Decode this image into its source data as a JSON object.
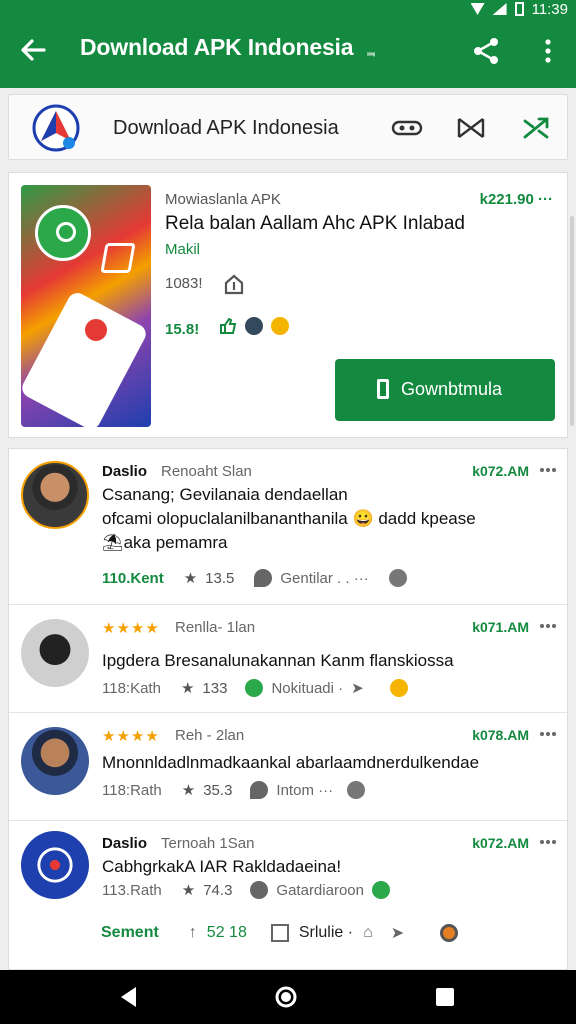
{
  "status_bar": {
    "time": "11:39"
  },
  "app_bar": {
    "title": "Download APK Indonesia",
    "title_suffix": "ᆿ"
  },
  "header": {
    "title": "Download APK Indonesia"
  },
  "app": {
    "subtitle": "Mowiaslanla APK",
    "price": "k221.90",
    "name": "Rela balan Aallam Ahc APK Inlabad",
    "vendor": "Makil",
    "size": "1083!",
    "rating": "15.8!",
    "download_label": "Gownbtmula",
    "accent": "#138a3f",
    "thumb_colors": [
      "#2e9b46",
      "#e53935",
      "#f4a000",
      "#8e44ad",
      "#1e3fae"
    ]
  },
  "comments": [
    {
      "user": "Daslio",
      "meta": "Renoaht Slan",
      "date": "k072.AM",
      "text_lines": [
        "Csanang; Gevilanaia dendaellan",
        "ofcami olopuclalanilbananthanila 😀 dadd kpease",
        "⛱aka pemamra"
      ],
      "count": "110.Kent",
      "stars_val": "13.5",
      "tag": "Gentilar . . ···"
    },
    {
      "stars": "★★★★",
      "meta": "Renlla- 1lan",
      "date": "k071.AM",
      "text_lines": [
        "Ipgdera Bresanalunakannan Kanm flanskiossa"
      ],
      "count": "118:Kath",
      "stars_val": "133",
      "tag": "Nokituadi ·"
    },
    {
      "stars": "★★★★",
      "meta": "Reh - 2lan",
      "date": "k078.AM",
      "text_lines": [
        "Mnonnldadlnmadkaankal abarlaamdnerdulkendae"
      ],
      "count": "118:Rath",
      "stars_val": "35.3",
      "tag": "Intom ···"
    },
    {
      "user": "Daslio",
      "meta": "Ternoah 1San",
      "date": "k072.AM",
      "text_lines": [
        "CabhgrkakA IAR Rakldadaeina!"
      ],
      "count": "113.Rath",
      "stars_val": "74.3",
      "tag": "Gatardiaroon"
    }
  ],
  "bottom_actions": {
    "segment": "Sement",
    "votes": "52 18",
    "label": "Srlulie ·"
  },
  "icons": [
    "back-arrow-icon",
    "share-icon",
    "more-vert-icon",
    "vpn-icon",
    "bow-icon",
    "shuffle-icon",
    "install-icon",
    "download-icon",
    "star-icon",
    "location-icon"
  ]
}
